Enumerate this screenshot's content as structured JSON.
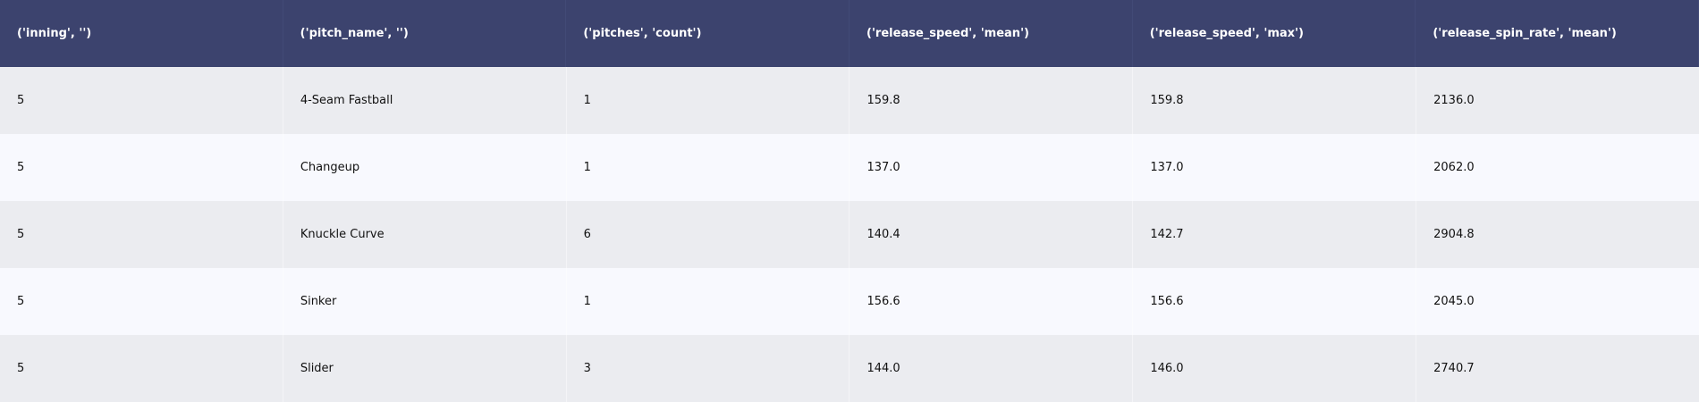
{
  "chart_data": {
    "type": "table",
    "columns": [
      "('inning', '')",
      "('pitch_name', '')",
      "('pitches', 'count')",
      "('release_speed', 'mean')",
      "('release_speed', 'max')",
      "('release_spin_rate', 'mean')"
    ],
    "rows": [
      [
        "5",
        "4-Seam Fastball",
        "1",
        "159.8",
        "159.8",
        "2136.0"
      ],
      [
        "5",
        "Changeup",
        "1",
        "137.0",
        "137.0",
        "2062.0"
      ],
      [
        "5",
        "Knuckle Curve",
        "6",
        "140.4",
        "142.7",
        "2904.8"
      ],
      [
        "5",
        "Sinker",
        "1",
        "156.6",
        "156.6",
        "2045.0"
      ],
      [
        "5",
        "Slider",
        "3",
        "144.0",
        "146.0",
        "2740.7"
      ]
    ]
  },
  "colors": {
    "header_bg": "#3c436e",
    "row_odd_bg": "#ebecf0",
    "row_even_bg": "#f8f9fe"
  }
}
